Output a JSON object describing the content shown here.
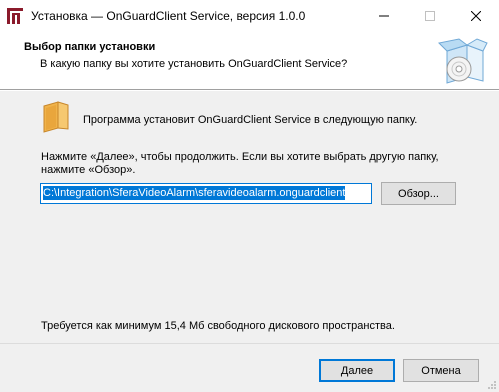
{
  "window": {
    "title": "Установка — OnGuardClient Service, версия 1.0.0",
    "controls": {
      "minimize": "minimize-icon",
      "maximize": "maximize-icon",
      "close": "close-icon"
    }
  },
  "header": {
    "title": "Выбор папки установки",
    "subtitle": "В какую папку вы хотите установить OnGuardClient Service?",
    "image": "installer-box-cd-icon"
  },
  "content": {
    "intro": "Программа установит OnGuardClient Service в следующую папку.",
    "instruction_line1": "Нажмите «Далее», чтобы продолжить. Если вы хотите выбрать другую папку,",
    "instruction_line2": "нажмите «Обзор».",
    "path_value": "C:\\Integration\\SferaVideoAlarm\\sferavideoalarm.onguardclient",
    "browse_label": "Обзор...",
    "space_required": "Требуется как минимум 15,4 Мб свободного дискового пространства."
  },
  "footer": {
    "next_label": "Далее",
    "cancel_label": "Отмена"
  },
  "colors": {
    "accent": "#0078d7",
    "folder": "#e8a33a",
    "logo": "#8b1a2b"
  }
}
